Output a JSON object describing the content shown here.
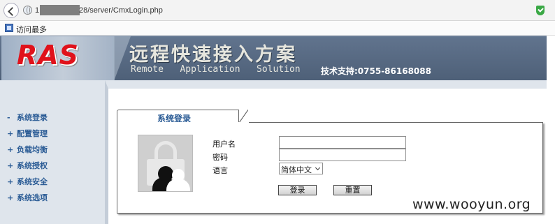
{
  "browser": {
    "url_prefix": "1",
    "url_visible": "28/server/CmxLogin.php",
    "favorites_label": "访问最多"
  },
  "banner": {
    "logo": "RAS",
    "title_cn": "远程快速接入方案",
    "title_en": "Remote   Application   Solution",
    "support": "技术支持:0755-86168088"
  },
  "sidebar": {
    "items": [
      {
        "mark": "-",
        "label": "系统登录"
      },
      {
        "mark": "+",
        "label": "配置管理"
      },
      {
        "mark": "+",
        "label": "负载均衡"
      },
      {
        "mark": "+",
        "label": "系统授权"
      },
      {
        "mark": "+",
        "label": "系统安全"
      },
      {
        "mark": "+",
        "label": "系统选项"
      }
    ]
  },
  "login": {
    "tab_title": "系统登录",
    "username_label": "用户名",
    "username_value": "",
    "password_label": "密码",
    "password_value": "",
    "language_label": "语言",
    "language_selected": "简体中文",
    "login_button": "登录",
    "reset_button": "重置"
  },
  "watermark": "www.wooyun.org",
  "colors": {
    "banner": "#56687f",
    "logo_red": "#e0121b",
    "nav_blue": "#2a5b95",
    "sidebar_bg": "#dfe5ec",
    "secure_green": "#3aa845"
  }
}
